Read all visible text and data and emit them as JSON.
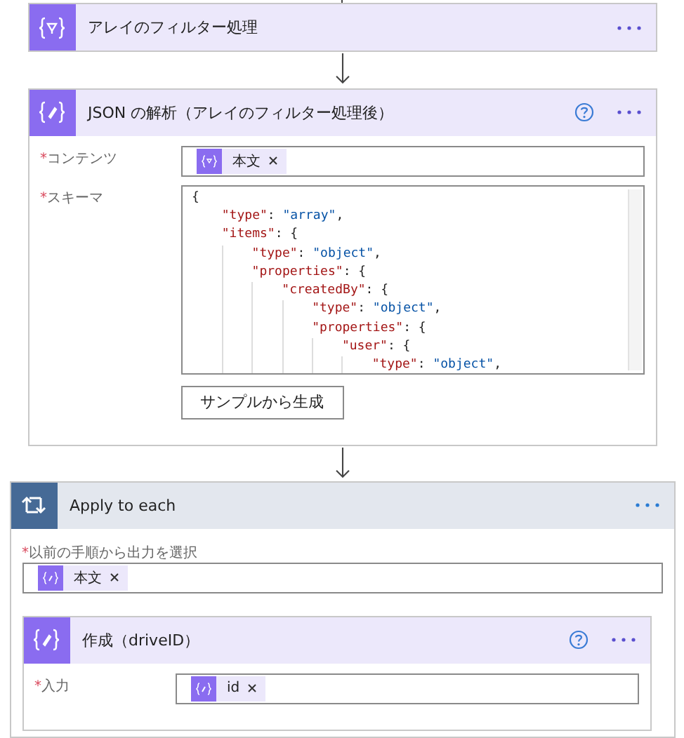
{
  "flow": [
    {
      "kind": "filter",
      "title": "アレイのフィルター処理",
      "help": false
    },
    {
      "kind": "parse",
      "title": "JSON の解析（アレイのフィルター処理後）",
      "help": true,
      "fields": [
        {
          "kind": "tokens",
          "mark": "*",
          "label": "コンテンツ",
          "tokens": [
            {
              "kind": "filter",
              "text": "本文"
            }
          ]
        },
        {
          "kind": "code",
          "mark": "*",
          "label": "スキーマ",
          "lines": [
            {
              "tokens": [
                {
                  "kind": "punct",
                  "text": "{"
                }
              ],
              "children": [
                {
                  "tokens": [
                    {
                      "kind": "key",
                      "text": "\"type\""
                    },
                    {
                      "kind": "punct",
                      "text": ": "
                    },
                    {
                      "kind": "string",
                      "text": "\"array\""
                    },
                    {
                      "kind": "punct",
                      "text": ","
                    }
                  ]
                },
                {
                  "tokens": [
                    {
                      "kind": "key",
                      "text": "\"items\""
                    },
                    {
                      "kind": "punct",
                      "text": ": {"
                    }
                  ],
                  "children": [
                    {
                      "tokens": [
                        {
                          "kind": "key",
                          "text": "\"type\""
                        },
                        {
                          "kind": "punct",
                          "text": ": "
                        },
                        {
                          "kind": "string",
                          "text": "\"object\""
                        },
                        {
                          "kind": "punct",
                          "text": ","
                        }
                      ]
                    },
                    {
                      "tokens": [
                        {
                          "kind": "key",
                          "text": "\"properties\""
                        },
                        {
                          "kind": "punct",
                          "text": ": {"
                        }
                      ],
                      "children": [
                        {
                          "tokens": [
                            {
                              "kind": "key",
                              "text": "\"createdBy\""
                            },
                            {
                              "kind": "punct",
                              "text": ": {"
                            }
                          ],
                          "children": [
                            {
                              "tokens": [
                                {
                                  "kind": "key",
                                  "text": "\"type\""
                                },
                                {
                                  "kind": "punct",
                                  "text": ": "
                                },
                                {
                                  "kind": "string",
                                  "text": "\"object\""
                                },
                                {
                                  "kind": "punct",
                                  "text": ","
                                }
                              ]
                            },
                            {
                              "tokens": [
                                {
                                  "kind": "key",
                                  "text": "\"properties\""
                                },
                                {
                                  "kind": "punct",
                                  "text": ": {"
                                }
                              ],
                              "children": [
                                {
                                  "tokens": [
                                    {
                                      "kind": "key",
                                      "text": "\"user\""
                                    },
                                    {
                                      "kind": "punct",
                                      "text": ": {"
                                    }
                                  ],
                                  "children": [
                                    {
                                      "tokens": [
                                        {
                                          "kind": "key",
                                          "text": "\"type\""
                                        },
                                        {
                                          "kind": "punct",
                                          "text": ": "
                                        },
                                        {
                                          "kind": "string",
                                          "text": "\"object\""
                                        },
                                        {
                                          "kind": "punct",
                                          "text": ","
                                        }
                                      ]
                                    }
                                  ]
                                }
                              ]
                            }
                          ]
                        }
                      ]
                    }
                  ]
                }
              ]
            }
          ],
          "button": "サンプルから生成"
        }
      ]
    },
    {
      "kind": "loop",
      "title": "Apply to each",
      "help": false,
      "fields": [
        {
          "kind": "tokens",
          "stacked": true,
          "mark": "*",
          "label": "以前の手順から出力を選択",
          "tokens": [
            {
              "kind": "compose",
              "text": "本文"
            }
          ]
        }
      ],
      "children": [
        {
          "kind": "compose",
          "title": "作成（driveID）",
          "help": true,
          "fields": [
            {
              "kind": "tokens",
              "stacked": false,
              "mark": "*",
              "label": "入力",
              "tokens": [
                {
                  "kind": "compose",
                  "text": "id"
                }
              ]
            }
          ]
        }
      ]
    }
  ]
}
